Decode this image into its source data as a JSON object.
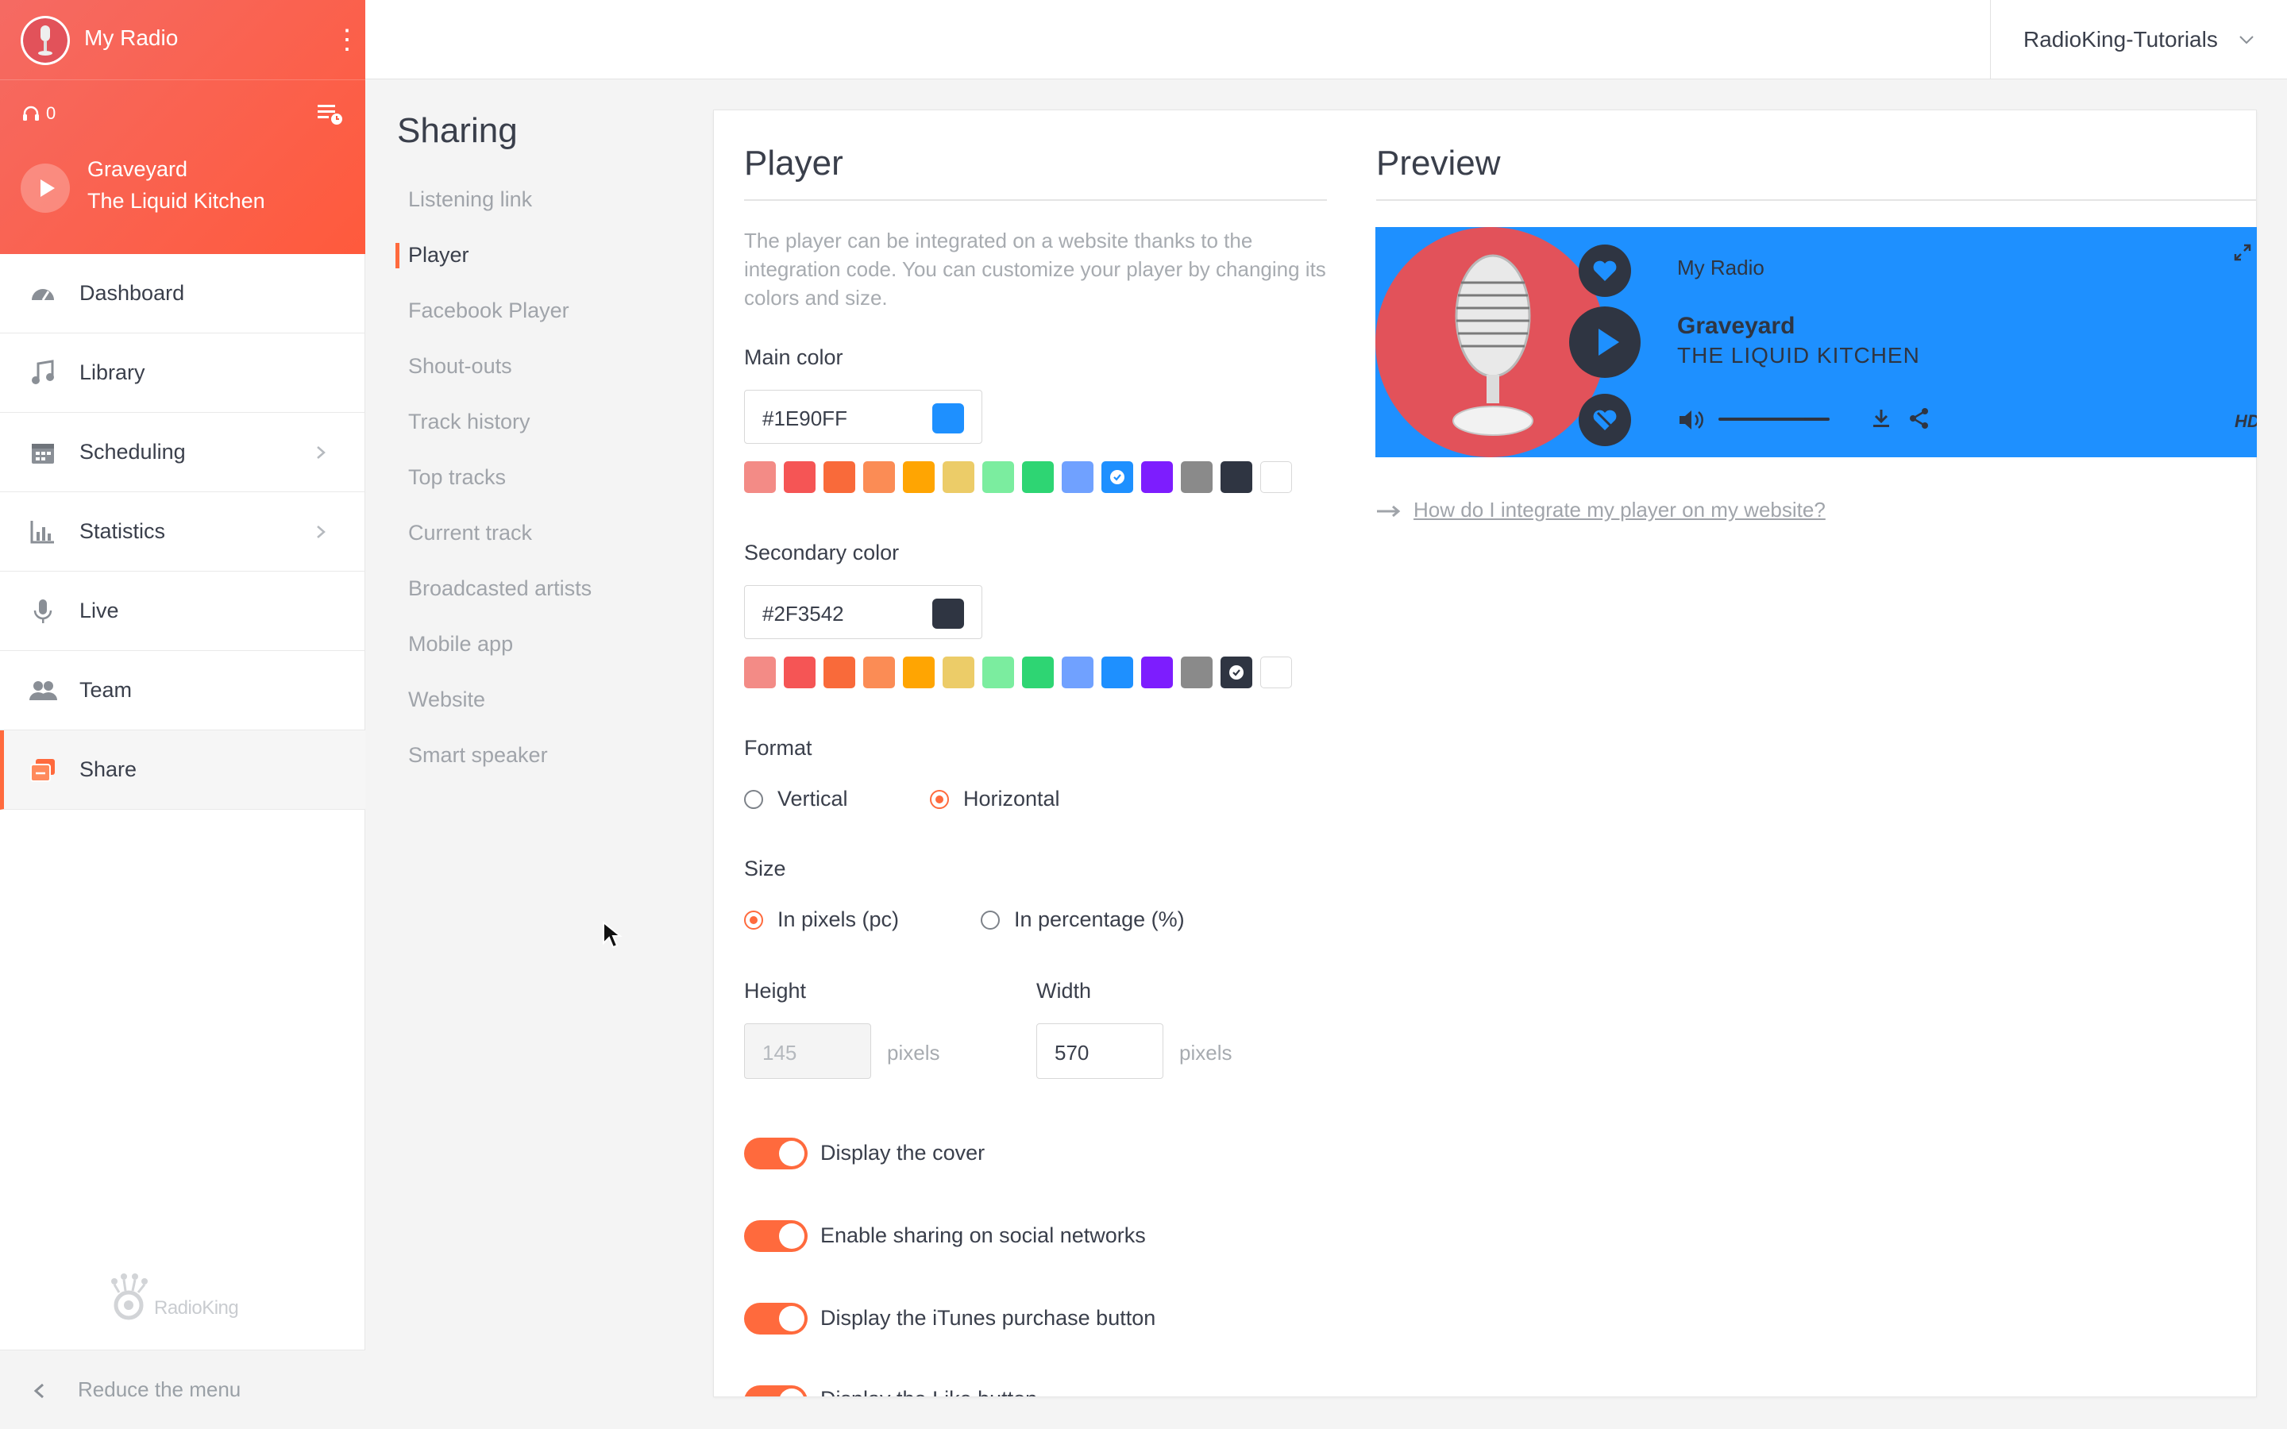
{
  "sidebar": {
    "station_name": "My Radio",
    "listeners": "0",
    "now_playing": {
      "title": "Graveyard",
      "artist": "The Liquid Kitchen"
    },
    "nav": [
      {
        "label": "Dashboard",
        "icon": "dashboard-icon"
      },
      {
        "label": "Library",
        "icon": "music-note-icon"
      },
      {
        "label": "Scheduling",
        "icon": "calendar-icon"
      },
      {
        "label": "Statistics",
        "icon": "bar-chart-icon"
      },
      {
        "label": "Live",
        "icon": "microphone-icon"
      },
      {
        "label": "Team",
        "icon": "team-icon"
      },
      {
        "label": "Share",
        "icon": "share-icon"
      }
    ],
    "brand": "RadioKing",
    "reduce_label": "Reduce the menu"
  },
  "topbar": {
    "account": "RadioKing-Tutorials"
  },
  "sharing": {
    "title": "Sharing",
    "items": [
      "Listening link",
      "Player",
      "Facebook Player",
      "Shout-outs",
      "Track history",
      "Top tracks",
      "Current track",
      "Broadcasted artists",
      "Mobile app",
      "Website",
      "Smart speaker"
    ],
    "active": "Player"
  },
  "player_settings": {
    "title": "Player",
    "description": "The player can be integrated on a website thanks to the integration code. You can customize your player by changing its colors and size.",
    "main_color_label": "Main color",
    "main_color_value": "#1E90FF",
    "secondary_color_label": "Secondary color",
    "secondary_color_value": "#2F3542",
    "palette": [
      "#f38b86",
      "#f55555",
      "#f96a3a",
      "#fb8c55",
      "#ffa502",
      "#eccc68",
      "#7bed9f",
      "#2ed573",
      "#70a1ff",
      "#1e90ff",
      "#7d1dfe",
      "#8a8a8a",
      "#2f3542",
      "#ffffff"
    ],
    "format_label": "Format",
    "format_options": [
      "Vertical",
      "Horizontal"
    ],
    "format_selected": "Horizontal",
    "size_label": "Size",
    "size_options": [
      "In pixels (pc)",
      "In percentage (%)"
    ],
    "size_selected": "In pixels (pc)",
    "height_label": "Height",
    "height_value": "145",
    "width_label": "Width",
    "width_value": "570",
    "unit": "pixels",
    "toggles": [
      {
        "label": "Display the cover",
        "on": true
      },
      {
        "label": "Enable sharing on social networks",
        "on": true
      },
      {
        "label": "Display the iTunes purchase button",
        "on": true
      },
      {
        "label": "Display the Like button",
        "on": true
      }
    ]
  },
  "preview": {
    "title": "Preview",
    "station": "My Radio",
    "track_title": "Graveyard",
    "track_artist": "THE LIQUID KITCHEN",
    "hd_label": "HD",
    "help_link": "How do I integrate my player on my website?"
  },
  "colors": {
    "accent": "#ff6a3d",
    "player_main": "#1e90ff",
    "player_secondary": "#2f3542"
  }
}
